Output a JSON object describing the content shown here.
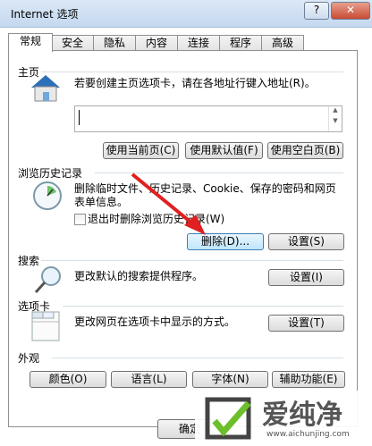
{
  "window": {
    "title": "Internet 选项",
    "help_label": "?",
    "close_label": "✕"
  },
  "tabs": [
    "常规",
    "安全",
    "隐私",
    "内容",
    "连接",
    "程序",
    "高级"
  ],
  "home": {
    "heading": "主页",
    "description": "若要创建主页选项卡，请在各地址行键入地址(R)。",
    "url_value": "",
    "buttons": [
      "使用当前页(C)",
      "使用默认值(F)",
      "使用空白页(B)"
    ]
  },
  "history": {
    "heading": "浏览历史记录",
    "description": "删除临时文件、历史记录、Cookie、保存的密码和网页表单信息。",
    "checkbox_label": "退出时删除浏览历史记录(W)",
    "checkbox_checked": false,
    "delete_button": "删除(D)...",
    "settings_button": "设置(S)"
  },
  "search": {
    "heading": "搜索",
    "description": "更改默认的搜索提供程序。",
    "settings_button": "设置(I)"
  },
  "tabs_section": {
    "heading": "选项卡",
    "description": "更改网页在选项卡中显示的方式。",
    "settings_button": "设置(T)"
  },
  "appearance": {
    "heading": "外观",
    "buttons": [
      "颜色(O)",
      "语言(L)",
      "字体(N)",
      "辅助功能(E)"
    ]
  },
  "footer": {
    "ok_label": "确定"
  },
  "watermark": {
    "name": "爱纯净",
    "url": "www.aichunjing.com"
  },
  "colors": {
    "annotation_arrow": "#e02020"
  }
}
